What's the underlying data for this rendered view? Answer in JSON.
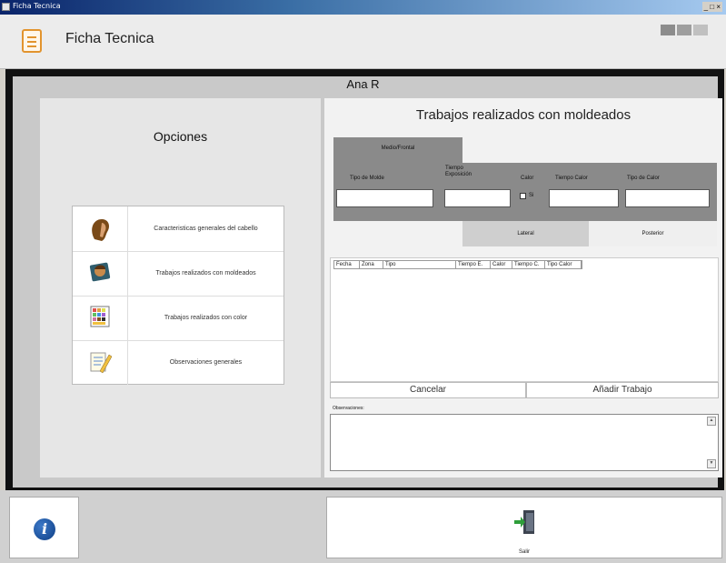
{
  "window": {
    "title": "Ficha Tecnica",
    "controls": "_ □ ×"
  },
  "header": {
    "app_title": "Ficha Tecnica",
    "tile_colors": [
      "#8c8c8c",
      "#9e9e9e",
      "#c0c0c0"
    ]
  },
  "user": {
    "name": "Ana R"
  },
  "left": {
    "heading": "Opciones",
    "menu": [
      {
        "label": "Caracteristicas generales del cabello",
        "icon": "hair-profile-icon"
      },
      {
        "label": "Trabajos realizados con moldeados",
        "icon": "hair-photo-icon"
      },
      {
        "label": "Trabajos realizados con color",
        "icon": "color-palette-icon"
      },
      {
        "label": "Observaciones generales",
        "icon": "notepad-pencil-icon"
      }
    ]
  },
  "right": {
    "heading": "Trabajos realizados con moldeados",
    "tab_top": "Medio/Frontal",
    "fields": {
      "tipo_molde": "Tipo de Molde",
      "tiempo_exposicion": "Tiempo Exposición",
      "calor": "Calor",
      "calor_check": "Si",
      "tiempo_calor": "Tiempo Calor",
      "tipo_calor": "Tipo de Calor"
    },
    "tabs_bottom": [
      "Lateral",
      "Posterior"
    ],
    "grid_columns": [
      "Fecha",
      "Zona",
      "Tipo",
      "Tiempo E.",
      "Calor",
      "Tiempo C.",
      "Tipo Calor"
    ],
    "cancel_label": "Cancelar",
    "add_label": "Añadir Trabajo",
    "obs_label": "Observaciones:"
  },
  "footer": {
    "exit_label": "Salir"
  },
  "colors": {
    "frame": "#111111",
    "form_band": "#8a8a8a",
    "info_blue": "#1e5bb0",
    "exit_green": "#2e9e3a"
  }
}
